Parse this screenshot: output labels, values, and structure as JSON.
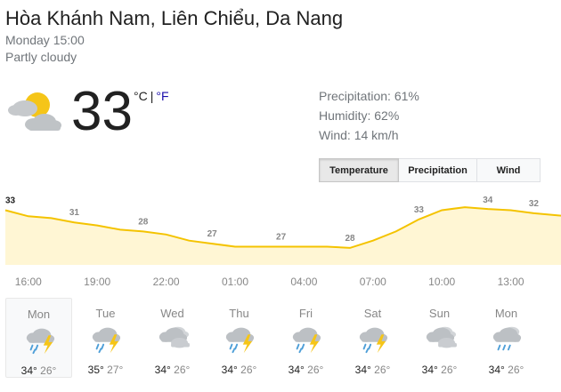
{
  "location": "Hòa Khánh Nam, Liên Chiểu, Da Nang",
  "datetime": "Monday 15:00",
  "condition": "Partly cloudy",
  "current": {
    "temperature": "33",
    "unit_c": "°C",
    "unit_separator": "|",
    "unit_f": "°F",
    "icon": "partly-cloudy-icon"
  },
  "details": {
    "precipitation_label": "Precipitation:",
    "precipitation_value": "61%",
    "humidity_label": "Humidity:",
    "humidity_value": "62%",
    "wind_label": "Wind:",
    "wind_value": "14 km/h"
  },
  "tabs": {
    "temperature": "Temperature",
    "precipitation": "Precipitation",
    "wind": "Wind",
    "selected": "Temperature"
  },
  "colors": {
    "chart_line": "#f4c300",
    "chart_fill": "#fff6d4",
    "accent_link": "#1a0dab",
    "rain": "#4e9fd8",
    "lightning": "#f5c518",
    "cloud": "#c6c9cc"
  },
  "chart_data": {
    "type": "area",
    "x": [
      "15:00",
      "16:00",
      "17:00",
      "18:00",
      "19:00",
      "20:00",
      "21:00",
      "22:00",
      "23:00",
      "00:00",
      "01:00",
      "02:00",
      "03:00",
      "04:00",
      "05:00",
      "06:00",
      "07:00",
      "08:00",
      "09:00",
      "10:00",
      "11:00",
      "12:00",
      "13:00",
      "14:00"
    ],
    "values": [
      33,
      32,
      31.7,
      31,
      30.5,
      29.8,
      29.5,
      29,
      28,
      27.5,
      27,
      27,
      27,
      27,
      27,
      26.8,
      28,
      29.5,
      31.5,
      33,
      33.5,
      33.2,
      33,
      32.5
    ],
    "labels": [
      {
        "index": 0,
        "value": "33"
      },
      {
        "index": 3,
        "value": "31"
      },
      {
        "index": 6,
        "value": "28"
      },
      {
        "index": 9,
        "value": "27"
      },
      {
        "index": 12,
        "value": "27"
      },
      {
        "index": 15,
        "value": "28"
      },
      {
        "index": 18,
        "value": "33"
      },
      {
        "index": 21,
        "value": "34"
      },
      {
        "index": 23,
        "value": "32"
      }
    ],
    "xticks": [
      "16:00",
      "19:00",
      "22:00",
      "01:00",
      "04:00",
      "07:00",
      "10:00",
      "13:00"
    ],
    "xlabel": "",
    "ylabel": "",
    "ylim": [
      24,
      36
    ],
    "grid": false,
    "legend": "none"
  },
  "forecast": [
    {
      "day": "Mon",
      "hi": "34°",
      "lo": "26°",
      "icon": "thunderstorm-icon",
      "selected": true
    },
    {
      "day": "Tue",
      "hi": "35°",
      "lo": "27°",
      "icon": "thunderstorm-icon",
      "selected": false
    },
    {
      "day": "Wed",
      "hi": "34°",
      "lo": "26°",
      "icon": "cloudy-icon",
      "selected": false
    },
    {
      "day": "Thu",
      "hi": "34°",
      "lo": "26°",
      "icon": "thunderstorm-icon",
      "selected": false
    },
    {
      "day": "Fri",
      "hi": "34°",
      "lo": "26°",
      "icon": "thunderstorm-icon",
      "selected": false
    },
    {
      "day": "Sat",
      "hi": "34°",
      "lo": "26°",
      "icon": "thunderstorm-icon",
      "selected": false
    },
    {
      "day": "Sun",
      "hi": "34°",
      "lo": "26°",
      "icon": "cloudy-icon",
      "selected": false
    },
    {
      "day": "Mon",
      "hi": "34°",
      "lo": "26°",
      "icon": "rain-showers-icon",
      "selected": false
    }
  ]
}
